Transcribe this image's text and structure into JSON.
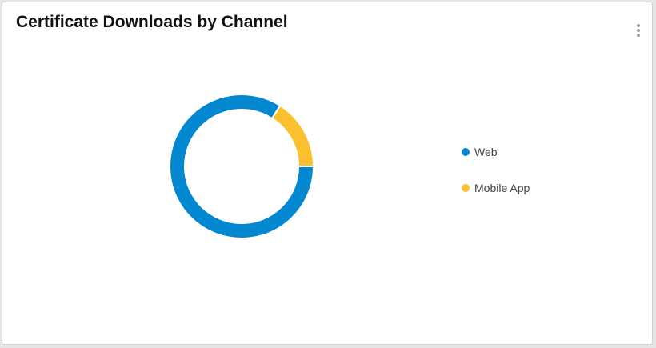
{
  "card": {
    "title": "Certificate Downloads by Channel"
  },
  "menu": {
    "icon": "more-vertical-icon"
  },
  "chart_data": {
    "type": "pie",
    "variant": "donut",
    "title": "Certificate Downloads by Channel",
    "categories": [
      "Web",
      "Mobile App"
    ],
    "values": [
      84,
      16
    ],
    "colors": [
      "#0288d1",
      "#fbc02d"
    ],
    "legend_position": "right"
  }
}
